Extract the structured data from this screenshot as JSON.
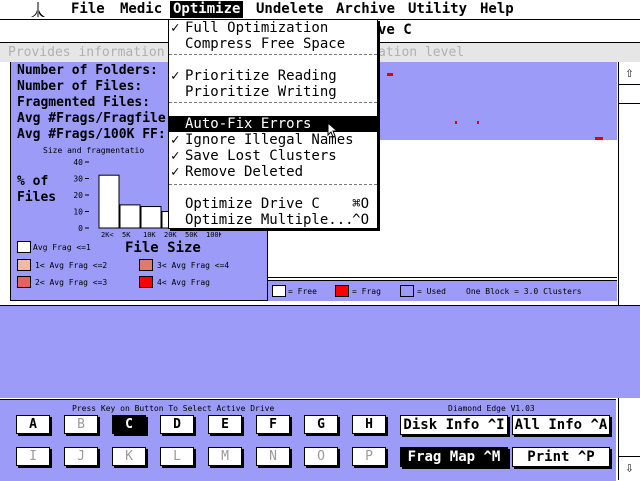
{
  "menubar": {
    "items": [
      "File",
      "Medic",
      "Optimize",
      "Undelete",
      "Archive",
      "Utility",
      "Help"
    ]
  },
  "window": {
    "title_tail": "ve C"
  },
  "infobar": {
    "left_text": "Provides information",
    "right_text": "ation level"
  },
  "stats": {
    "folders_label": "Number of Folders:",
    "files_label": "Number of Files:",
    "fragmented_label": "Fragmented Files:",
    "avg_frags_label": "Avg #Frags/Fragfile",
    "avg_100k_label": "Avg #Frags/100K FF:"
  },
  "histogram": {
    "title": "Size and fragmentatio",
    "ylabel_line1": "% of",
    "ylabel_line2": "Files",
    "xlabel": "File Size"
  },
  "chart_data": {
    "type": "bar",
    "title": "Size and fragmentatio",
    "categories": [
      "2K<",
      "5K",
      "10K",
      "20K",
      "50K",
      "100K",
      "<100K"
    ],
    "values": [
      32,
      14,
      13,
      10,
      5,
      3,
      2
    ],
    "ylim": [
      0,
      40
    ],
    "yticks": [
      0,
      10,
      20,
      30,
      40
    ],
    "xlabel": "File Size",
    "ylabel": "% of Files"
  },
  "frag_legend": [
    {
      "label": "Avg Frag <=1",
      "color": "#ffffff"
    },
    {
      "label": "1< Avg Frag <=2",
      "color": "#f2b8a8"
    },
    {
      "label": "3< Avg Frag <=4",
      "color": "#e07a70"
    },
    {
      "label": "2< Avg Frag <=3",
      "color": "#e86060"
    },
    {
      "label": "4< Avg Frag",
      "color": "#ff0000"
    }
  ],
  "map_legend": {
    "free": "= Free",
    "frag": "= Frag",
    "used": "= Used",
    "block": "One Block = 3.0 Clusters"
  },
  "optimize_menu": {
    "items": [
      {
        "label": "Full Optimization",
        "checked": true,
        "shortcut": ""
      },
      {
        "label": "Compress Free Space",
        "checked": false,
        "shortcut": ""
      },
      {
        "label": "Prioritize Reading",
        "checked": true,
        "shortcut": ""
      },
      {
        "label": "Prioritize Writing",
        "checked": false,
        "shortcut": ""
      },
      {
        "label": "Auto-Fix Errors",
        "checked": false,
        "shortcut": ""
      },
      {
        "label": "Ignore Illegal Names",
        "checked": true,
        "shortcut": ""
      },
      {
        "label": "Save Lost Clusters",
        "checked": true,
        "shortcut": ""
      },
      {
        "label": "Remove Deleted",
        "checked": true,
        "shortcut": ""
      },
      {
        "label": "Optimize Drive C",
        "checked": false,
        "shortcut": "⌘O"
      },
      {
        "label": "Optimize Multiple...",
        "checked": false,
        "shortcut": "^O"
      }
    ]
  },
  "bottom": {
    "hint": "Press Key on Button To Select Active Drive",
    "version": "Diamond Edge V1.03",
    "drives_row1": [
      "A",
      "B",
      "C",
      "D",
      "E",
      "F",
      "G",
      "H"
    ],
    "drives_row2": [
      "I",
      "J",
      "K",
      "L",
      "M",
      "N",
      "O",
      "P"
    ],
    "disk_info": "Disk Info ^I",
    "all_info": "All Info ^A",
    "frag_map": "Frag Map ^M",
    "print": "Print ^P"
  },
  "icons": {
    "logo": "atari-logo-icon",
    "scroll_up": "arrow-up-icon",
    "scroll_down": "arrow-down-icon"
  }
}
